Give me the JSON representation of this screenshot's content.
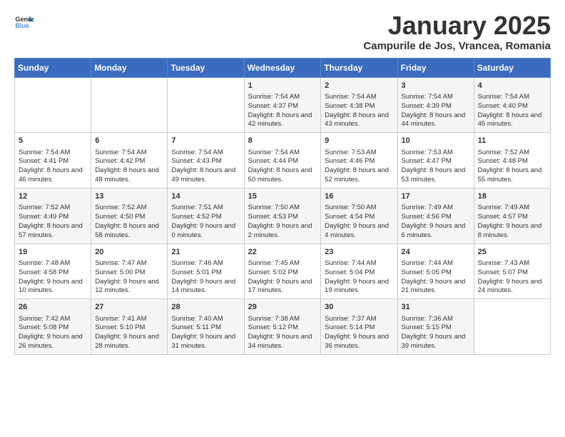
{
  "header": {
    "logo_general": "General",
    "logo_blue": "Blue",
    "month": "January 2025",
    "location": "Campurile de Jos, Vrancea, Romania"
  },
  "weekdays": [
    "Sunday",
    "Monday",
    "Tuesday",
    "Wednesday",
    "Thursday",
    "Friday",
    "Saturday"
  ],
  "weeks": [
    [
      {
        "day": "",
        "info": ""
      },
      {
        "day": "",
        "info": ""
      },
      {
        "day": "",
        "info": ""
      },
      {
        "day": "1",
        "info": "Sunrise: 7:54 AM\nSunset: 4:37 PM\nDaylight: 8 hours and 42 minutes."
      },
      {
        "day": "2",
        "info": "Sunrise: 7:54 AM\nSunset: 4:38 PM\nDaylight: 8 hours and 43 minutes."
      },
      {
        "day": "3",
        "info": "Sunrise: 7:54 AM\nSunset: 4:39 PM\nDaylight: 8 hours and 44 minutes."
      },
      {
        "day": "4",
        "info": "Sunrise: 7:54 AM\nSunset: 4:40 PM\nDaylight: 8 hours and 45 minutes."
      }
    ],
    [
      {
        "day": "5",
        "info": "Sunrise: 7:54 AM\nSunset: 4:41 PM\nDaylight: 8 hours and 46 minutes."
      },
      {
        "day": "6",
        "info": "Sunrise: 7:54 AM\nSunset: 4:42 PM\nDaylight: 8 hours and 48 minutes."
      },
      {
        "day": "7",
        "info": "Sunrise: 7:54 AM\nSunset: 4:43 PM\nDaylight: 8 hours and 49 minutes."
      },
      {
        "day": "8",
        "info": "Sunrise: 7:54 AM\nSunset: 4:44 PM\nDaylight: 8 hours and 50 minutes."
      },
      {
        "day": "9",
        "info": "Sunrise: 7:53 AM\nSunset: 4:46 PM\nDaylight: 8 hours and 52 minutes."
      },
      {
        "day": "10",
        "info": "Sunrise: 7:53 AM\nSunset: 4:47 PM\nDaylight: 8 hours and 53 minutes."
      },
      {
        "day": "11",
        "info": "Sunrise: 7:52 AM\nSunset: 4:48 PM\nDaylight: 8 hours and 55 minutes."
      }
    ],
    [
      {
        "day": "12",
        "info": "Sunrise: 7:52 AM\nSunset: 4:49 PM\nDaylight: 8 hours and 57 minutes."
      },
      {
        "day": "13",
        "info": "Sunrise: 7:52 AM\nSunset: 4:50 PM\nDaylight: 8 hours and 58 minutes."
      },
      {
        "day": "14",
        "info": "Sunrise: 7:51 AM\nSunset: 4:52 PM\nDaylight: 9 hours and 0 minutes."
      },
      {
        "day": "15",
        "info": "Sunrise: 7:50 AM\nSunset: 4:53 PM\nDaylight: 9 hours and 2 minutes."
      },
      {
        "day": "16",
        "info": "Sunrise: 7:50 AM\nSunset: 4:54 PM\nDaylight: 9 hours and 4 minutes."
      },
      {
        "day": "17",
        "info": "Sunrise: 7:49 AM\nSunset: 4:56 PM\nDaylight: 9 hours and 6 minutes."
      },
      {
        "day": "18",
        "info": "Sunrise: 7:49 AM\nSunset: 4:57 PM\nDaylight: 9 hours and 8 minutes."
      }
    ],
    [
      {
        "day": "19",
        "info": "Sunrise: 7:48 AM\nSunset: 4:58 PM\nDaylight: 9 hours and 10 minutes."
      },
      {
        "day": "20",
        "info": "Sunrise: 7:47 AM\nSunset: 5:00 PM\nDaylight: 9 hours and 12 minutes."
      },
      {
        "day": "21",
        "info": "Sunrise: 7:46 AM\nSunset: 5:01 PM\nDaylight: 9 hours and 14 minutes."
      },
      {
        "day": "22",
        "info": "Sunrise: 7:45 AM\nSunset: 5:02 PM\nDaylight: 9 hours and 17 minutes."
      },
      {
        "day": "23",
        "info": "Sunrise: 7:44 AM\nSunset: 5:04 PM\nDaylight: 9 hours and 19 minutes."
      },
      {
        "day": "24",
        "info": "Sunrise: 7:44 AM\nSunset: 5:05 PM\nDaylight: 9 hours and 21 minutes."
      },
      {
        "day": "25",
        "info": "Sunrise: 7:43 AM\nSunset: 5:07 PM\nDaylight: 9 hours and 24 minutes."
      }
    ],
    [
      {
        "day": "26",
        "info": "Sunrise: 7:42 AM\nSunset: 5:08 PM\nDaylight: 9 hours and 26 minutes."
      },
      {
        "day": "27",
        "info": "Sunrise: 7:41 AM\nSunset: 5:10 PM\nDaylight: 9 hours and 28 minutes."
      },
      {
        "day": "28",
        "info": "Sunrise: 7:40 AM\nSunset: 5:11 PM\nDaylight: 9 hours and 31 minutes."
      },
      {
        "day": "29",
        "info": "Sunrise: 7:38 AM\nSunset: 5:12 PM\nDaylight: 9 hours and 34 minutes."
      },
      {
        "day": "30",
        "info": "Sunrise: 7:37 AM\nSunset: 5:14 PM\nDaylight: 9 hours and 36 minutes."
      },
      {
        "day": "31",
        "info": "Sunrise: 7:36 AM\nSunset: 5:15 PM\nDaylight: 9 hours and 39 minutes."
      },
      {
        "day": "",
        "info": ""
      }
    ]
  ]
}
